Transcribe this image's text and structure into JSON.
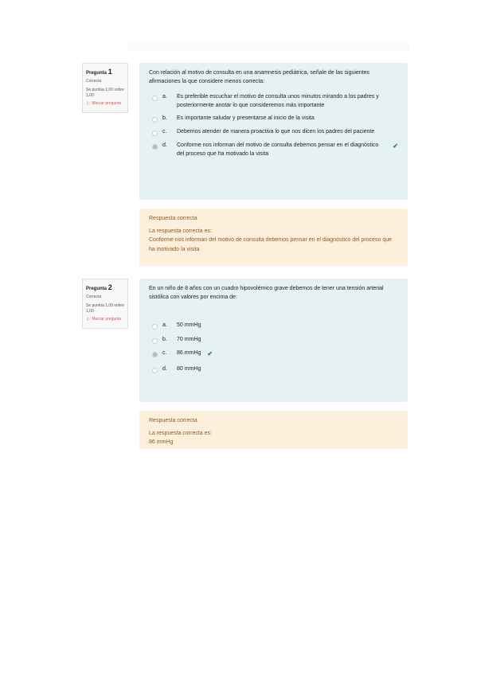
{
  "questions": [
    {
      "label": "Pregunta",
      "number": "1",
      "state": "Correcta",
      "grade": "Se puntúa 1,00 sobre 1,00",
      "flag": "Marcar pregunta",
      "text": "Con relación al motivo de consulta en una anamnesis pediátrica, señale de las siguientes afirmaciones la que considere menos correcta:",
      "answers": [
        {
          "letter": "a.",
          "text": "Es preferible escuchar el motivo de consulta unos minutos mirando a los padres y posteriormente anotar lo que consideremos más importante"
        },
        {
          "letter": "b.",
          "text": "Es importante saludar y presentarse al inicio de la visita"
        },
        {
          "letter": "c.",
          "text": "Debemos atender de manera proactiva lo que nos dicen los padres del paciente"
        },
        {
          "letter": "d.",
          "text": "Conforme nos informan del motivo de consulta debemos pensar en el diagnóstico del proceso que ha motivado la visita"
        }
      ],
      "feedback_title": "Respuesta correcta",
      "feedback_label": "La respuesta correcta es:",
      "feedback_answer": "Conforme nos informan del motivo de consulta debemos pensar en el diagnóstico del proceso que ha motivado la visita"
    },
    {
      "label": "Pregunta",
      "number": "2",
      "state": "Correcta",
      "grade": "Se puntúa 1,00 sobre 1,00",
      "flag": "Marcar pregunta",
      "text": "En un niño de 8 años con un cuadro hipovolémico grave debemos de tener una tensión arterial sistólica con valores por encima de:",
      "answers": [
        {
          "letter": "a.",
          "text": "50 mmHg"
        },
        {
          "letter": "b.",
          "text": "70 mmHg"
        },
        {
          "letter": "c.",
          "text": "86 mmHg"
        },
        {
          "letter": "d.",
          "text": "80 mmHg"
        }
      ],
      "feedback_title": "Respuesta correcta",
      "feedback_label": "La respuesta correcta es:",
      "feedback_answer": "86 mmHg"
    }
  ],
  "icons": {
    "flag": "flag-icon",
    "check": "check-icon",
    "radio": "radio-icon"
  },
  "colors": {
    "question_bg": "#e5f1f3",
    "feedback_bg": "#fcefdc",
    "feedback_text": "#8e5b22",
    "flag": "#d9534f",
    "check": "#2d8a34"
  }
}
